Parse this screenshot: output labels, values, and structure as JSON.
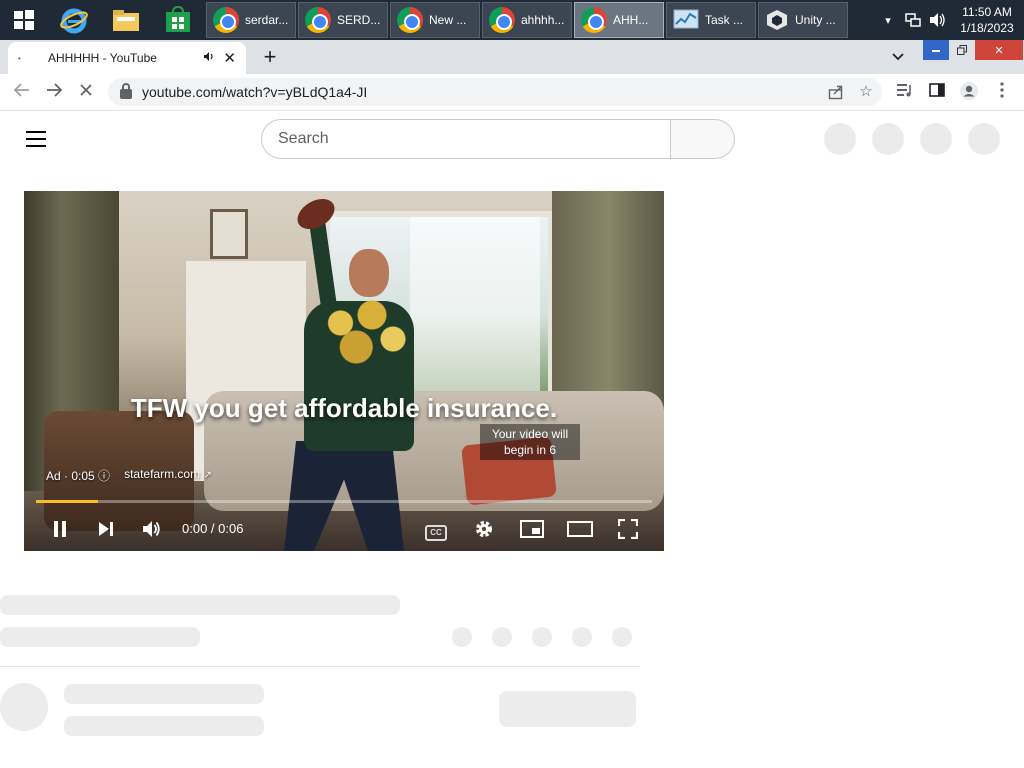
{
  "taskbar": {
    "tasks": [
      {
        "label": "serdar...",
        "icon": "chrome-icon"
      },
      {
        "label": "SERD...",
        "icon": "chrome-icon"
      },
      {
        "label": "New ...",
        "icon": "chrome-icon"
      },
      {
        "label": "ahhhh...",
        "icon": "chrome-icon"
      },
      {
        "label": "AHH...",
        "icon": "chrome-icon"
      },
      {
        "label": "Task ...",
        "icon": "task-manager-icon"
      },
      {
        "label": "Unity ...",
        "icon": "unity-icon"
      }
    ],
    "clock": {
      "time": "11:50 AM",
      "date": "1/18/2023"
    },
    "tray_overflow": "▾"
  },
  "browser": {
    "tab": {
      "title": "AHHHHH - YouTube"
    },
    "new_tab": "+",
    "url": "youtube.com/watch?v=yBLdQ1a4-JI"
  },
  "youtube": {
    "search": {
      "placeholder": "Search"
    },
    "player": {
      "caption": "TFW you get affordable insurance.",
      "skip_text": "Your video will begin in 6",
      "ad_label": "Ad · 0:05",
      "ad_site": "statefarm.com",
      "timecode": "0:00 / 0:06",
      "progress": 0.1,
      "progress_color": "#fbbf24",
      "cc_label": "CC"
    }
  }
}
